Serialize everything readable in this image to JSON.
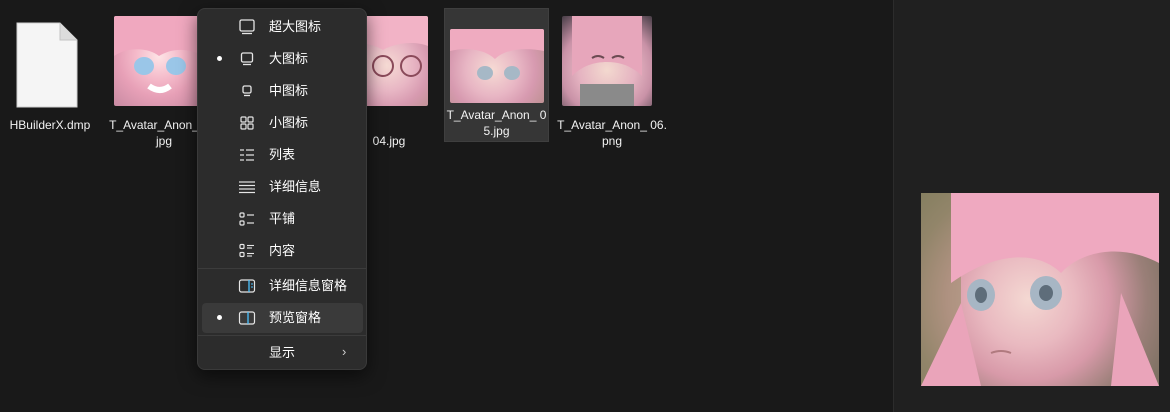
{
  "files": [
    {
      "name": "HBuilderX.dmp",
      "type": "document-icon"
    },
    {
      "name": "T_Avatar_Anon_01.jpg",
      "type": "image-thumbnail"
    },
    {
      "name": "T_Avatar_Anon_04.jpg",
      "type": "image-thumbnail"
    },
    {
      "name": "T_Avatar_Anon_05.jpg",
      "type": "image-thumbnail",
      "selected": true
    },
    {
      "name": "T_Avatar_Anon_06.png",
      "type": "image-thumbnail"
    }
  ],
  "labels": {
    "f0": "HBuilderX.dmp",
    "f1": "T_Avatar_Anon_ 01.jpg",
    "f2": "04.jpg",
    "f3": "T_Avatar_Anon_ 05.jpg",
    "f4": "T_Avatar_Anon_ 06.png"
  },
  "menu": {
    "items": [
      {
        "label": "超大图标",
        "icon": "extra-large-icons-icon",
        "checked": false
      },
      {
        "label": "大图标",
        "icon": "large-icons-icon",
        "checked": true
      },
      {
        "label": "中图标",
        "icon": "medium-icons-icon",
        "checked": false
      },
      {
        "label": "小图标",
        "icon": "small-icons-icon",
        "checked": false
      },
      {
        "label": "列表",
        "icon": "list-icon",
        "checked": false
      },
      {
        "label": "详细信息",
        "icon": "details-icon",
        "checked": false
      },
      {
        "label": "平铺",
        "icon": "tiles-icon",
        "checked": false
      },
      {
        "label": "内容",
        "icon": "content-icon",
        "checked": false
      },
      {
        "label": "详细信息窗格",
        "icon": "details-pane-icon",
        "checked": false
      },
      {
        "label": "预览窗格",
        "icon": "preview-pane-icon",
        "checked": true,
        "highlighted": true
      },
      {
        "label": "显示",
        "icon": "chevron-right-icon",
        "submenu": true
      }
    ]
  },
  "colors": {
    "background": "#191919",
    "menu_background": "#2c2c2c",
    "pane_icon_accent": "#4cc2ff"
  }
}
